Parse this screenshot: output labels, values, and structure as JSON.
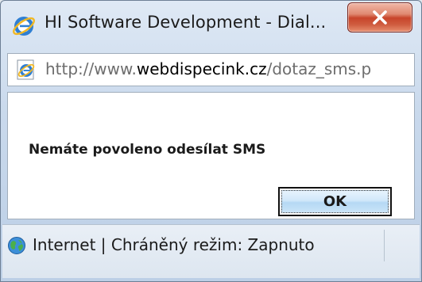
{
  "window": {
    "title": "HI Software Development - Dial...",
    "title_icon": "ie-icon",
    "close_icon": "close-icon"
  },
  "address_bar": {
    "prefix": "http://www.",
    "domain": "webdispecink.cz",
    "path": "/dotaz_sms.p",
    "icon": "ie-page-icon"
  },
  "dialog": {
    "message": "Nemáte povoleno odesílat SMS",
    "ok_label": "OK"
  },
  "status_bar": {
    "text": "Internet | Chráněný režim: Zapnuto",
    "icon": "globe-icon"
  },
  "colors": {
    "close_button": "#c8452b",
    "ok_button": "#b5d8f4",
    "chrome": "#c9d9ec"
  }
}
